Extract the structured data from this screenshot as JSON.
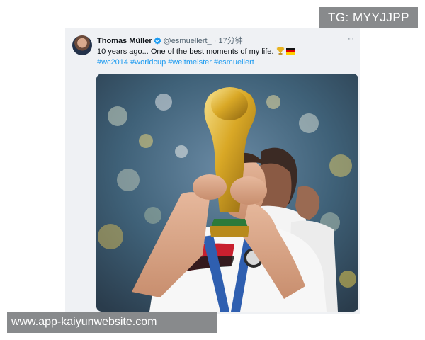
{
  "tweet": {
    "author_name": "Thomas Müller",
    "author_handle": "@esmuellert_",
    "separator": "·",
    "time": "17分钟",
    "text": "10 years ago... One of the best moments of my life.",
    "hashtags": [
      "#wc2014",
      "#worldcup",
      "#weltmeister",
      "#esmuellert"
    ],
    "more_label": "···",
    "verified_color": "#1d9bf0"
  },
  "overlays": {
    "tg_label": "TG: MYYJJPP",
    "url_label": "www.app-kaiyunwebsite.com"
  },
  "colors": {
    "link": "#1d9bf0",
    "card_bg": "#eff1f4",
    "overlay_bg": "#888a8c"
  }
}
